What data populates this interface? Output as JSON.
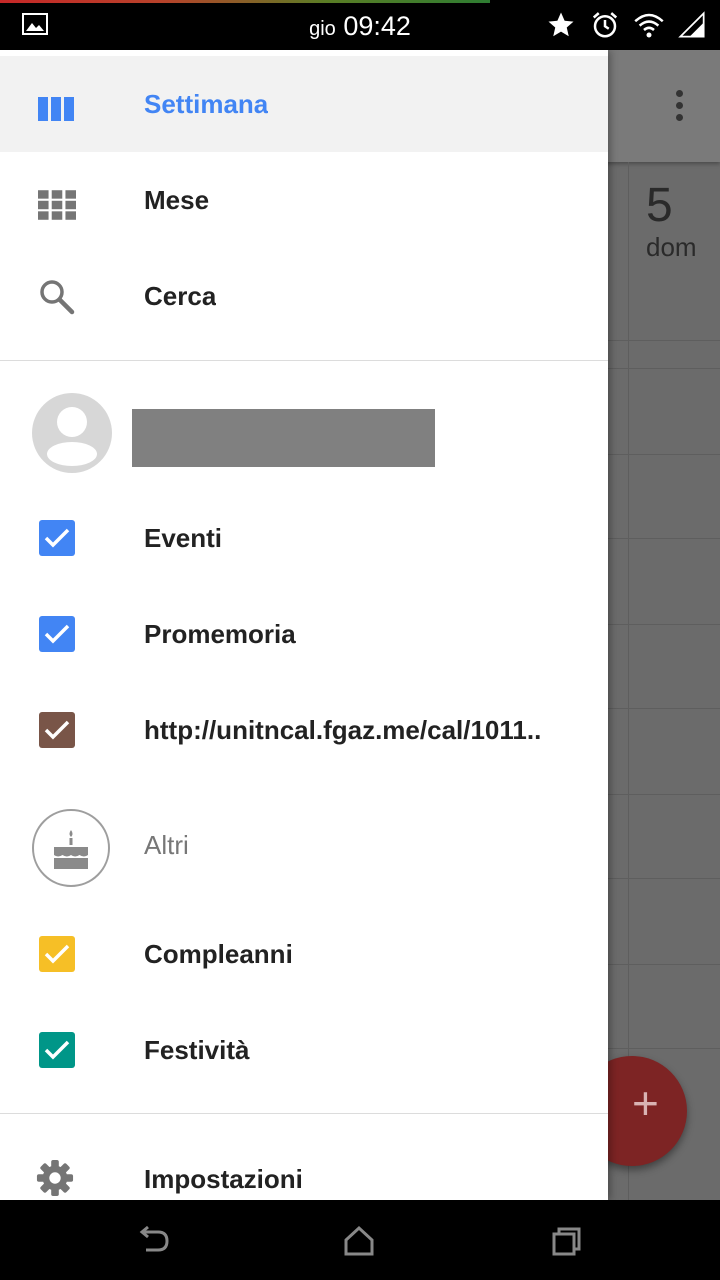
{
  "status_bar": {
    "day": "gio",
    "time": "09:42",
    "icons": [
      "image-icon",
      "star-icon",
      "alarm-icon",
      "wifi-icon",
      "signal-icon"
    ]
  },
  "background": {
    "day_number": "5",
    "day_name": "dom",
    "fab_icon": "+"
  },
  "drawer": {
    "views": [
      {
        "label": "Settimana",
        "icon": "week-view-icon",
        "selected": true
      },
      {
        "label": "Mese",
        "icon": "month-grid-icon",
        "selected": false
      },
      {
        "label": "Cerca",
        "icon": "search-icon",
        "selected": false
      }
    ],
    "account_calendars": [
      {
        "label": "Eventi",
        "checked": true,
        "color": "#4285f4"
      },
      {
        "label": "Promemoria",
        "checked": true,
        "color": "#4285f4"
      },
      {
        "label": "http://unitncal.fgaz.me/cal/1011..",
        "checked": true,
        "color": "#795548"
      }
    ],
    "others_header": "Altri",
    "other_calendars": [
      {
        "label": "Compleanni",
        "checked": true,
        "color": "#f6bf26"
      },
      {
        "label": "Festività",
        "checked": true,
        "color": "#009688"
      }
    ],
    "settings_label": "Impostazioni"
  },
  "colors": {
    "accent": "#4285f4",
    "fab": "#7d2424"
  }
}
